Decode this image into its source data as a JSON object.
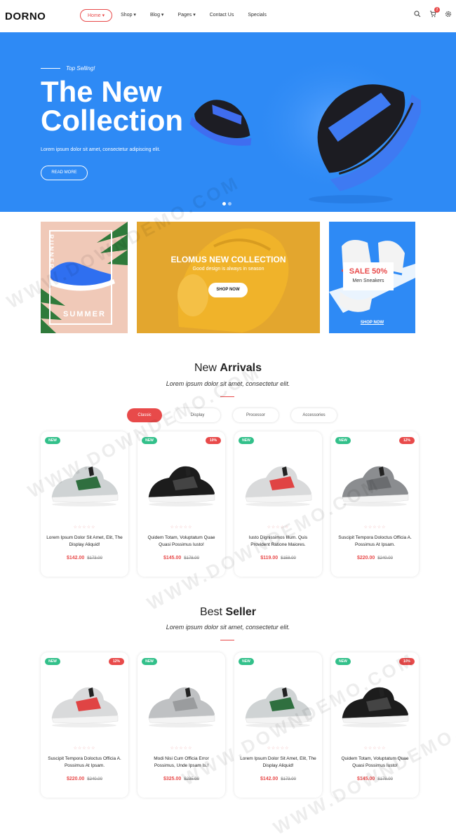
{
  "header": {
    "logo": "DORNO",
    "nav": [
      "Home ▾",
      "Shop ▾",
      "Blog ▾",
      "Pages ▾",
      "Contact Us",
      "Specials"
    ],
    "cart_count": "2"
  },
  "hero": {
    "tagline": "Top Selling!",
    "title": "The New Collection",
    "subtitle": "Lorem ipsum dolor sit amet, consectetur adipiscing elit.",
    "button": "READ MORE"
  },
  "banners": {
    "runner": "RUNNER",
    "summer": "SUMMER",
    "collection_title": "ELOMUS NEW COLLECTION",
    "collection_sub": "Good design is always in season",
    "collection_button": "SHOP NOW",
    "sale": "SALE 50%",
    "sale_sub": "Men Sneakers",
    "sale_link": "SHOP NOW"
  },
  "new_arrivals": {
    "title_light": "New ",
    "title_bold": "Arrivals",
    "subtitle": "Lorem ipsum dolor sit amet, consectetur elit.",
    "tabs": [
      "Classic",
      "Display",
      "Processor",
      "Accessories"
    ],
    "products": [
      {
        "new": "NEW",
        "off": "",
        "name": "Lorem Ipsum Dolor Sit Amet, Elit, The Display Aliquid!",
        "price": "$142.00",
        "old": "$173.00",
        "color": "#cfd3d4",
        "accent": "#2f6f3f"
      },
      {
        "new": "NEW",
        "off": "10%",
        "name": "Quidem Totam, Voluptatum Quae Quasi Possimus Iusto!",
        "price": "$145.00",
        "old": "$178.00",
        "color": "#1c1c1c",
        "accent": "#444"
      },
      {
        "new": "NEW",
        "off": "",
        "name": "Iusto Dignissimos Illum. Quis Provident Ratione Maiores.",
        "price": "$119.00",
        "old": "$158.00",
        "color": "#d9dadb",
        "accent": "#e04444"
      },
      {
        "new": "NEW",
        "off": "12%",
        "name": "Suscipit Tempora Doloctus Officia A. Possimus At Ipsam.",
        "price": "$220.00",
        "old": "$240.00",
        "color": "#8b8d90",
        "accent": "#6a6c6f"
      }
    ]
  },
  "best_seller": {
    "title_light": "Best ",
    "title_bold": "Seller",
    "subtitle": "Lorem ipsum dolor sit amet, consectetur elit.",
    "products": [
      {
        "new": "NEW",
        "off": "12%",
        "name": "Suscipit Tempora Doloctus Officia A. Possimus At Ipsam.",
        "price": "$220.00",
        "old": "$240.00",
        "color": "#d9dadb",
        "accent": "#e04444"
      },
      {
        "new": "NEW",
        "off": "",
        "name": "Modi Nisi Cum Officia Error Possimus, Unde Ipsam Is.!",
        "price": "$325.00",
        "old": "$235.00",
        "color": "#bfc1c3",
        "accent": "#9a9c9e"
      },
      {
        "new": "NEW",
        "off": "",
        "name": "Lorem Ipsum Dolor Sit Amet, Elit, The Display Aliquid!",
        "price": "$142.00",
        "old": "$173.00",
        "color": "#cfd3d4",
        "accent": "#2f6f3f"
      },
      {
        "new": "NEW",
        "off": "10%",
        "name": "Quidem Totam, Voluptatum Quae Quasi Possimus Iusto!",
        "price": "$145.00",
        "old": "$178.00",
        "color": "#1c1c1c",
        "accent": "#444"
      }
    ]
  },
  "colors": {
    "brand": "#e84a4a",
    "hero": "#2e8af5",
    "new_badge": "#32c08a"
  },
  "stars": "☆☆☆☆☆",
  "watermark": "WWW.DOWNDEMO.COM"
}
